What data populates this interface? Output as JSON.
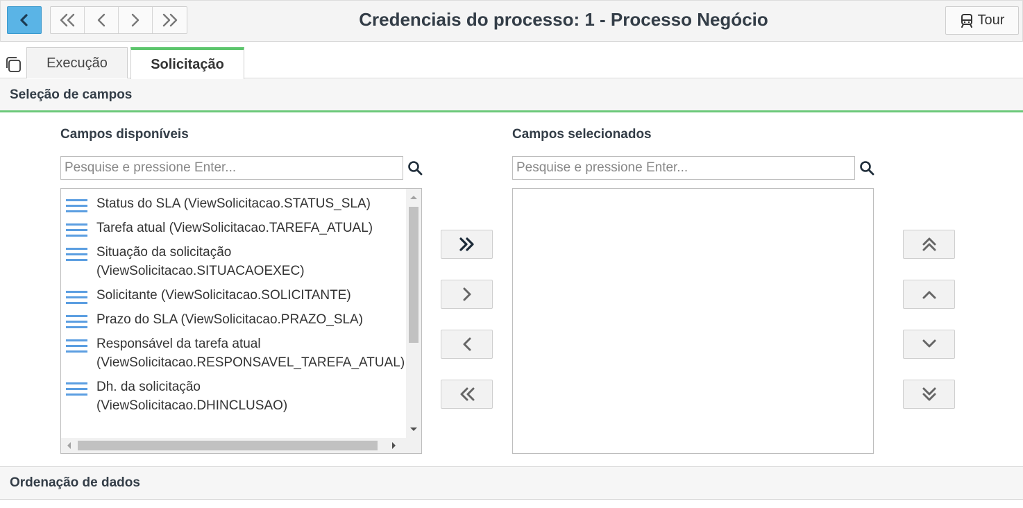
{
  "header": {
    "title": "Credenciais do processo: 1 - Processo Negócio",
    "tour_label": "Tour"
  },
  "tabs": [
    {
      "label": "Execução",
      "active": false
    },
    {
      "label": "Solicitação",
      "active": true
    }
  ],
  "sections": {
    "field_selection": "Seleção de campos",
    "data_ordering": "Ordenação de dados"
  },
  "available": {
    "label": "Campos disponíveis",
    "search_placeholder": "Pesquise e pressione Enter...",
    "items": [
      {
        "lines": [
          "Status do SLA (ViewSolicitacao.STATUS_SLA)"
        ]
      },
      {
        "lines": [
          "Tarefa atual (ViewSolicitacao.TAREFA_ATUAL)"
        ]
      },
      {
        "lines": [
          "Situação da solicitação",
          "(ViewSolicitacao.SITUACAOEXEC)"
        ]
      },
      {
        "lines": [
          "Solicitante (ViewSolicitacao.SOLICITANTE)"
        ]
      },
      {
        "lines": [
          "Prazo do SLA (ViewSolicitacao.PRAZO_SLA)"
        ]
      },
      {
        "lines": [
          "Responsável da tarefa atual",
          "(ViewSolicitacao.RESPONSAVEL_TAREFA_ATUAL)"
        ]
      },
      {
        "lines": [
          "Dh. da solicitação",
          "(ViewSolicitacao.DHINCLUSAO)"
        ]
      }
    ]
  },
  "selected": {
    "label": "Campos selecionados",
    "search_placeholder": "Pesquise e pressione Enter...",
    "items": []
  },
  "colors": {
    "accent_blue": "#5ab4e6",
    "tab_green": "#5cc56c",
    "list_icon_blue": "#5b9ee1"
  }
}
